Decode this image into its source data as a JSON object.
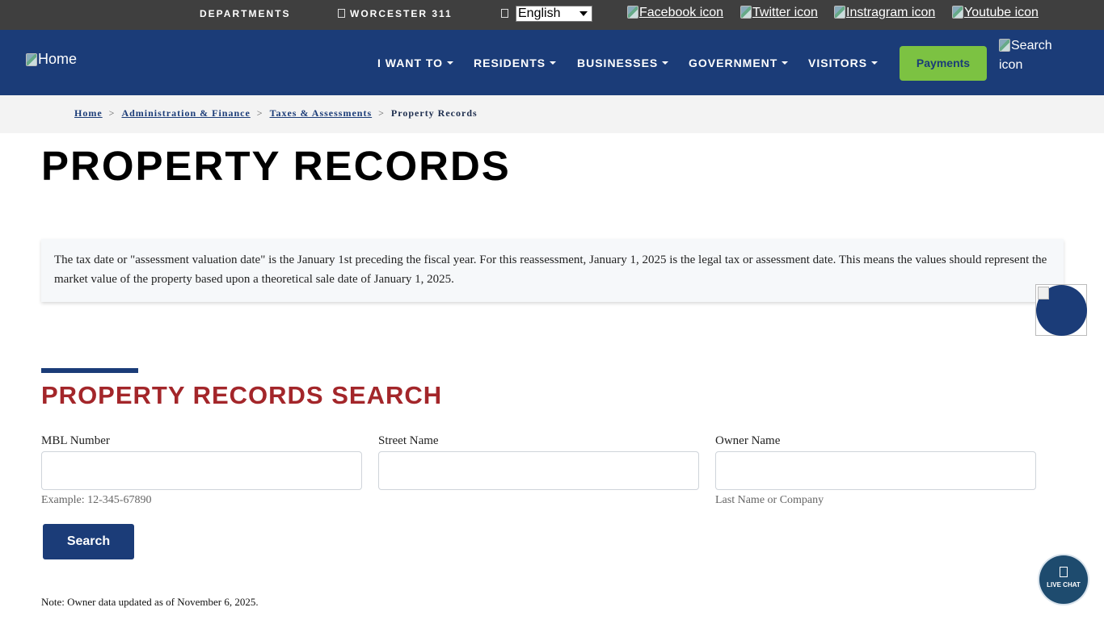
{
  "utility": {
    "departments": "DEPARTMENTS",
    "worcester311": "WORCESTER 311",
    "language": "English",
    "social": {
      "facebook": "Facebook icon",
      "twitter": "Twitter icon",
      "instagram": "Instragram icon",
      "youtube": "Youtube icon"
    }
  },
  "nav": {
    "home_alt": "Home",
    "items": [
      "I WANT TO",
      "RESIDENTS",
      "BUSINESSES",
      "GOVERNMENT",
      "VISITORS"
    ],
    "payments": "Payments",
    "search_alt": "Search icon"
  },
  "breadcrumb": {
    "items": [
      "Home",
      "Administration & Finance",
      "Taxes & Assessments"
    ],
    "current": "Property Records",
    "separator": ">"
  },
  "page": {
    "title": "PROPERTY RECORDS",
    "info": "The tax date or \"assessment valuation date\" is the January 1st preceding the fiscal year. For this reassessment, January 1, 2025 is the legal tax or assessment date. This means the values should represent the market value of the property based upon a theoretical sale date of January 1, 2025."
  },
  "search": {
    "title": "PROPERTY RECORDS SEARCH",
    "fields": [
      {
        "label": "MBL Number",
        "value": "",
        "hint": "Example: 12-345-67890"
      },
      {
        "label": "Street Name",
        "value": "",
        "hint": ""
      },
      {
        "label": "Owner Name",
        "value": "",
        "hint": "Last Name or Company"
      }
    ],
    "button": "Search",
    "note": "Note: Owner data updated as of November 6, 2025."
  },
  "live_chat": "LIVE CHAT",
  "colors": {
    "nav_bg": "#1b3c78",
    "utility_bg": "#3f3f3f",
    "payments_bg": "#7cc242",
    "section_title": "#a3262a"
  }
}
